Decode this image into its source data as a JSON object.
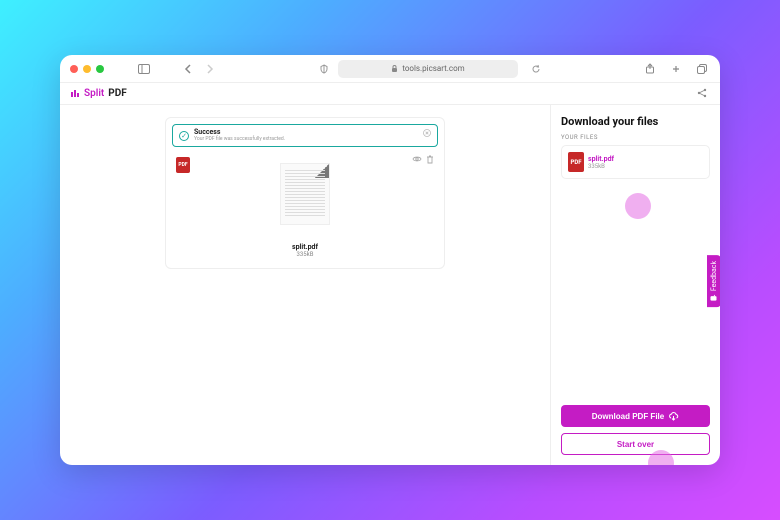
{
  "browser": {
    "url_host": "tools.picsart.com"
  },
  "app": {
    "brand_left": "Split",
    "brand_right": "PDF"
  },
  "banner": {
    "title": "Success",
    "subtitle": "Your PDF file was successfully extracted."
  },
  "preview": {
    "file_name": "split.pdf",
    "file_size": "335kB"
  },
  "sidebar": {
    "heading": "Download your files",
    "label": "YOUR FILES",
    "file": {
      "name": "split.pdf",
      "size": "335kB"
    },
    "download_label": "Download PDF File",
    "start_over_label": "Start over"
  },
  "feedback": {
    "label": "Feedback"
  },
  "icons": {
    "pdf_badge": "PDF"
  }
}
